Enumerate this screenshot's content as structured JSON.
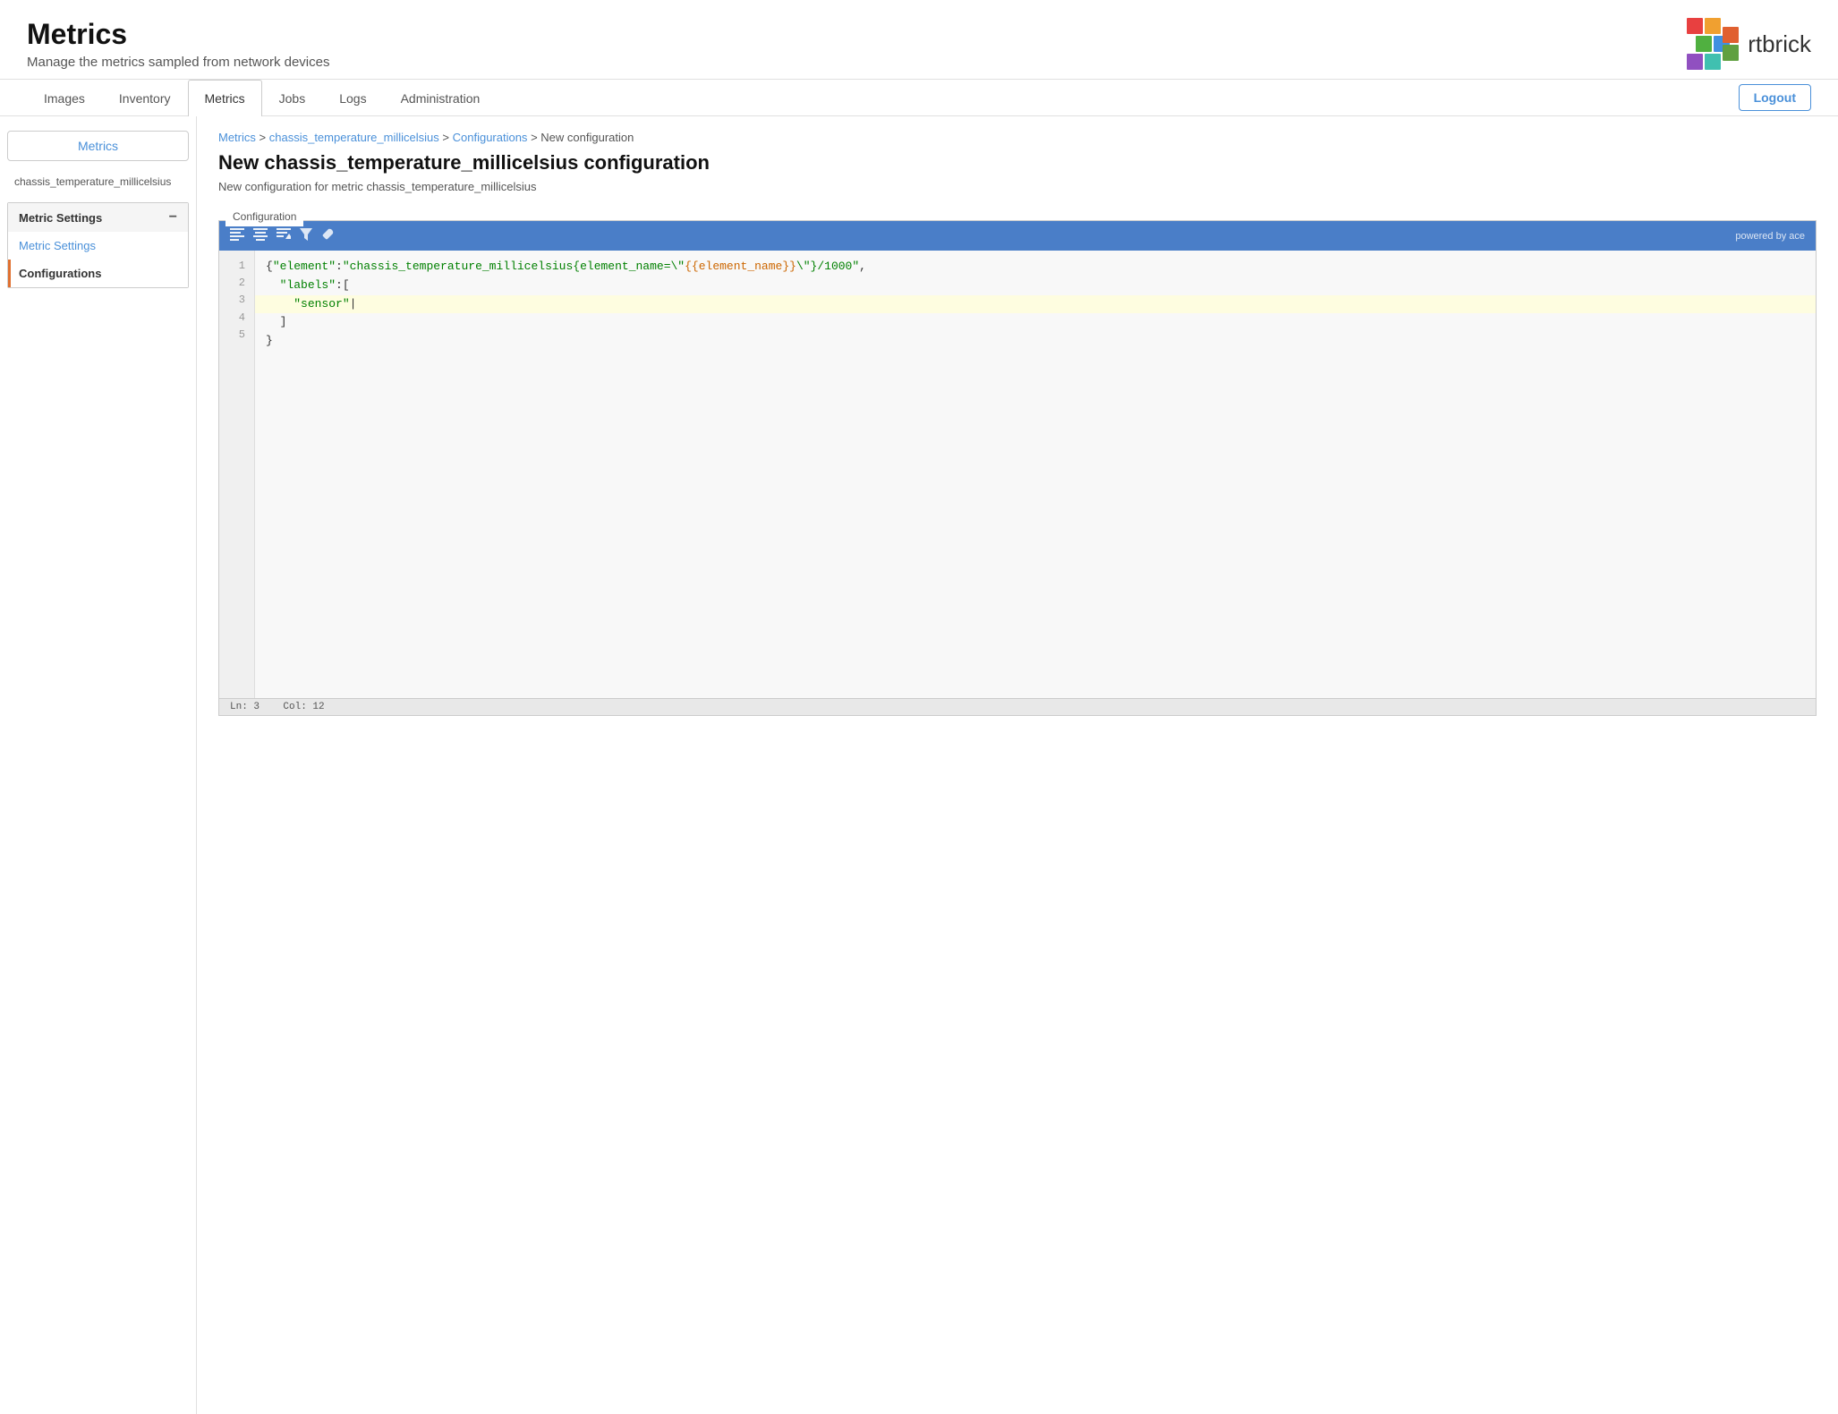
{
  "header": {
    "title": "Metrics",
    "subtitle": "Manage the metrics sampled from network devices",
    "logo_text": "rtbrick",
    "logout_label": "Logout"
  },
  "nav": {
    "items": [
      {
        "id": "images",
        "label": "Images",
        "active": false
      },
      {
        "id": "inventory",
        "label": "Inventory",
        "active": false
      },
      {
        "id": "metrics",
        "label": "Metrics",
        "active": true
      },
      {
        "id": "jobs",
        "label": "Jobs",
        "active": false
      },
      {
        "id": "logs",
        "label": "Logs",
        "active": false
      },
      {
        "id": "administration",
        "label": "Administration",
        "active": false
      }
    ]
  },
  "sidebar": {
    "metrics_link": "Metrics",
    "breadcrumb": "chassis_temperature_millicelsius",
    "section_title": "Metric Settings",
    "section_toggle": "−",
    "items": [
      {
        "id": "metric-settings",
        "label": "Metric Settings",
        "active": false
      },
      {
        "id": "configurations",
        "label": "Configurations",
        "active": true
      }
    ]
  },
  "breadcrumb": {
    "items": [
      {
        "label": "Metrics",
        "href": "#"
      },
      {
        "label": "chassis_temperature_millicelsius",
        "href": "#"
      },
      {
        "label": "Configurations",
        "href": "#"
      },
      {
        "label": "New configuration",
        "href": null
      }
    ]
  },
  "page": {
    "title": "New chassis_temperature_millicelsius configuration",
    "subtitle": "New configuration for metric chassis_temperature_millicelsius"
  },
  "editor": {
    "toolbar_icons": [
      "align-left",
      "align-center",
      "align-right-down",
      "filter",
      "wrench"
    ],
    "powered_by": "powered by ace",
    "lines": [
      {
        "num": 1,
        "content": "{\"element\":\"chassis_temperature_millicelsius{element_name=\\\"{{element_name}}\\\"}/ 1000\","
      },
      {
        "num": 2,
        "content": "  \"labels\":["
      },
      {
        "num": 3,
        "content": "    \"sensor\"",
        "highlighted": true
      },
      {
        "num": 4,
        "content": "  ]"
      },
      {
        "num": 5,
        "content": "}"
      }
    ],
    "statusbar": {
      "line": "Ln: 3",
      "col": "Col: 12"
    }
  }
}
